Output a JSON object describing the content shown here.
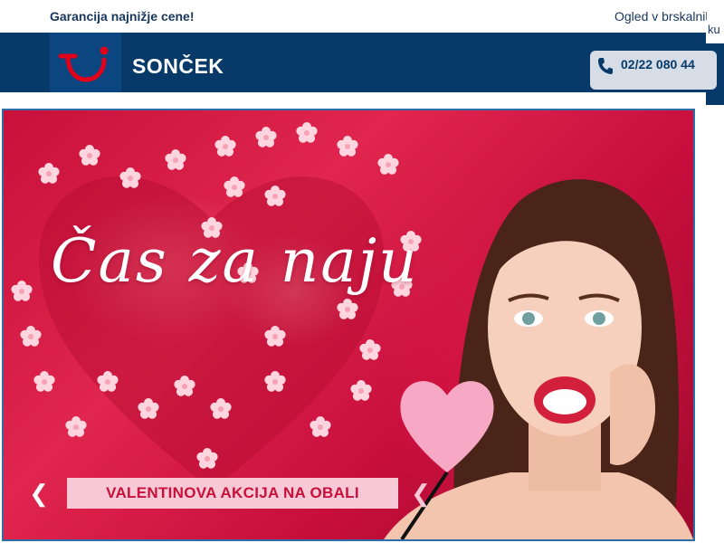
{
  "topbar": {
    "guarantee_text": "Garancija najnižje cene!",
    "browser_view_text": "Ogled v brskalniku",
    "browser_view_overflow": "ku"
  },
  "header": {
    "brand_name": "SONČEK",
    "phone_number": "02/22 080 44"
  },
  "banner": {
    "headline": "Čas za naju",
    "cta_label": "VALENTINOVA AKCIJA NA OBALI"
  },
  "colors": {
    "header_bg": "#073a69",
    "logo_red": "#e2001a",
    "banner_red": "#c8103a",
    "cta_bg": "#f7c8d6"
  },
  "icons": [
    "tui-smile-logo",
    "phone-icon",
    "chevron-left-icon",
    "chevron-right-icon"
  ]
}
